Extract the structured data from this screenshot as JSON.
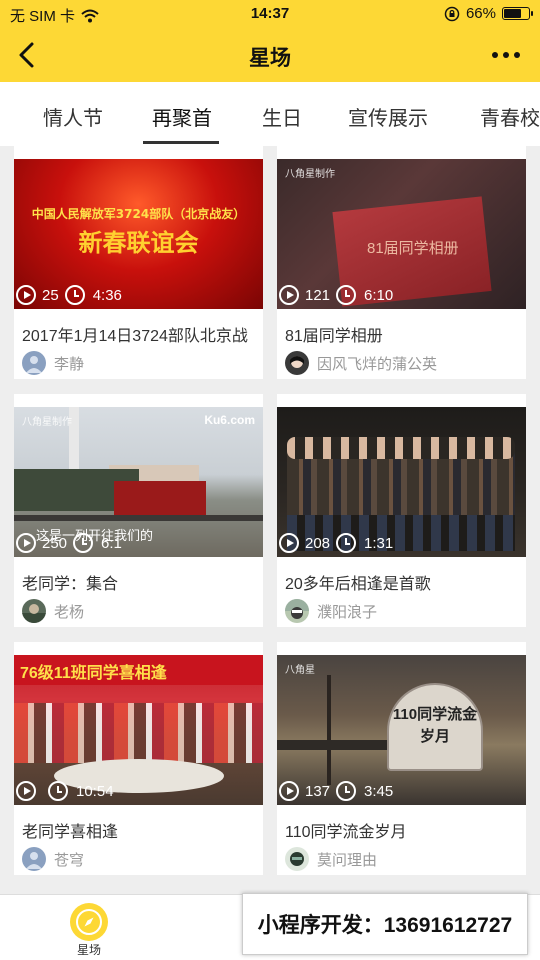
{
  "status_bar": {
    "carrier": "无 SIM 卡",
    "time": "14:37",
    "battery": "66%",
    "battery_level": 0.66
  },
  "nav": {
    "title": "星场",
    "back_icon": "back-arrow-icon",
    "more_icon": "more-dots-icon"
  },
  "tabs": [
    {
      "label": "情人节",
      "active": false
    },
    {
      "label": "再聚首",
      "active": true
    },
    {
      "label": "生日",
      "active": false
    },
    {
      "label": "宣传展示",
      "active": false
    },
    {
      "label": "青春校",
      "active": false
    }
  ],
  "cards": [
    {
      "title": "2017年1月14日3724部队北京战",
      "views": "25",
      "duration": "4:36",
      "author": "李静",
      "thumb_text_1": "中国人民解放军3724部队（北京战友）",
      "thumb_text_2": "新春联谊会"
    },
    {
      "title": "81届同学相册",
      "views": "121",
      "duration": "6:10",
      "author": "因风飞烊的蒲公英",
      "watermark": "八角星制作",
      "thumb_text_1": "81届同学相册"
    },
    {
      "title": "老同学：集合",
      "views": "250",
      "duration": "6:1",
      "author": "老杨",
      "watermark": "八角星制作",
      "thumb_text_1": "这是一列开往我们的",
      "thumb_badge": "Ku6.com"
    },
    {
      "title": "20多年后相逢是首歌",
      "views": "208",
      "duration": "1:31",
      "author": "濮阳浪子"
    },
    {
      "title": "老同学喜相逢",
      "views": "",
      "duration": "10:54",
      "author": "苍穹",
      "thumb_text_1": "76级11班同学喜相逢"
    },
    {
      "title": "110同学流金岁月",
      "views": "137",
      "duration": "3:45",
      "author": "莫问理由",
      "watermark": "八角星",
      "thumb_text_1": "110同学流金",
      "thumb_text_2": "岁月"
    }
  ],
  "bottom": {
    "home_label": "星场",
    "promo_text": "小程序开发：13691612727"
  },
  "colors": {
    "brand_yellow": "#fdd835"
  }
}
